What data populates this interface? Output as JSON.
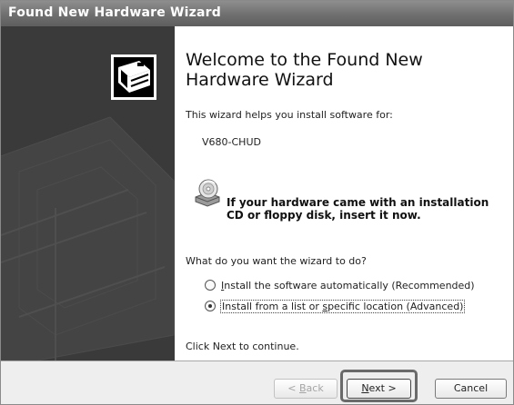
{
  "window": {
    "title": "Found New Hardware Wizard"
  },
  "main": {
    "heading": "Welcome to the Found New Hardware Wizard",
    "intro": "This wizard helps you install software for:",
    "device_name": "V680-CHUD",
    "cd_prompt": "If your hardware came with an installation CD or floppy disk, insert it now.",
    "question": "What do you want the wizard to do?",
    "options": [
      {
        "pre": "",
        "mnemonic": "I",
        "post": "nstall the software automatically (Recommended)",
        "selected": false
      },
      {
        "pre": "Install from a list or ",
        "mnemonic": "s",
        "post": "pecific location (Advanced)",
        "selected": true
      }
    ],
    "continue_hint": "Click Next to continue."
  },
  "buttons": {
    "back_pre": "< ",
    "back_mnemonic": "B",
    "back_post": "ack",
    "next_mnemonic": "N",
    "next_post": "ext >",
    "cancel": "Cancel"
  },
  "icons": {
    "wizard_graphic": "hardware-box-icon",
    "cd_icon": "cd-drive-icon"
  }
}
